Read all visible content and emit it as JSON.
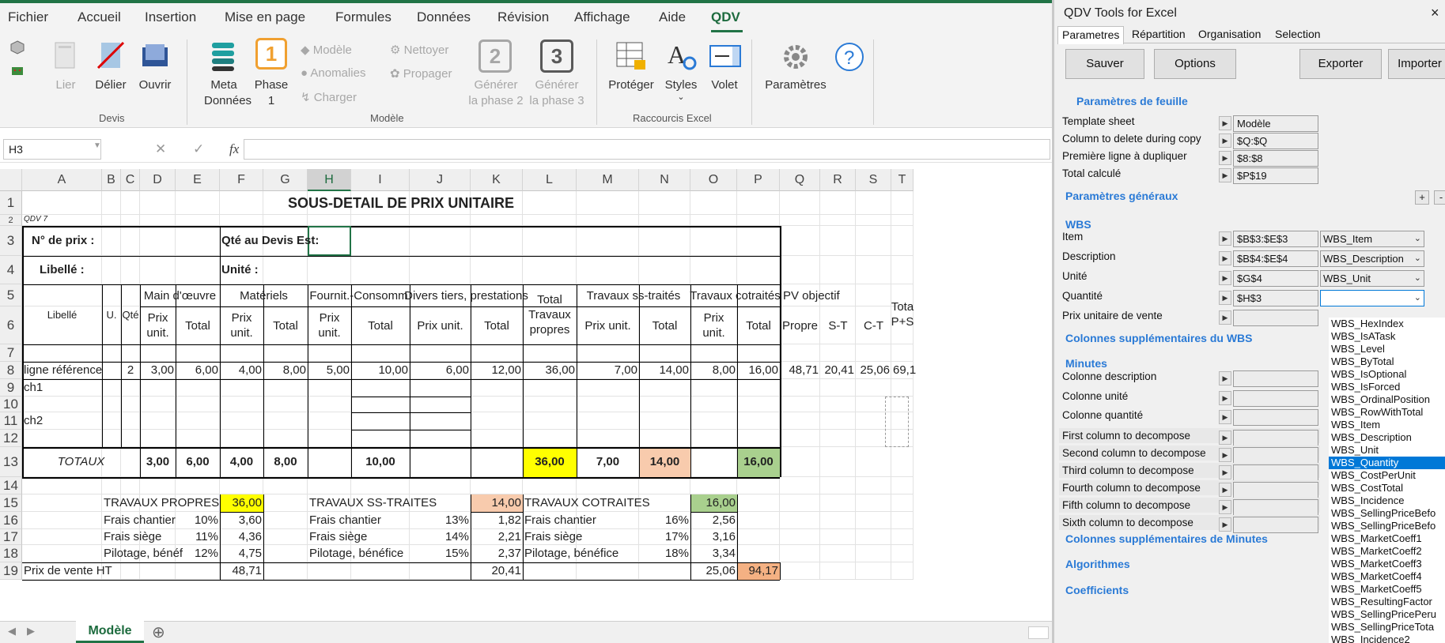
{
  "ribbon": {
    "menus": [
      "Fichier",
      "Accueil",
      "Insertion",
      "Mise en page",
      "Formules",
      "Données",
      "Révision",
      "Affichage",
      "Aide",
      "QDV"
    ],
    "devis": {
      "lier": "Lier",
      "delier": "Délier",
      "ouvrir": "Ouvrir",
      "group": "Devis"
    },
    "modele": {
      "meta1": "Meta",
      "meta2": "Données",
      "phase1": "Phase",
      "phase1b": "1",
      "modele": "Modèle",
      "anomalies": "Anomalies",
      "charger": "Charger",
      "nettoyer": "Nettoyer",
      "propager": "Propager",
      "gen2a": "Générer",
      "gen2b": "la phase 2",
      "gen3a": "Générer",
      "gen3b": "la phase 3",
      "group": "Modèle",
      "phase1_num": "1",
      "gen2_num": "2",
      "gen3_num": "3"
    },
    "raccourcis": {
      "proteger": "Protéger",
      "styles": "Styles",
      "volet": "Volet",
      "group": "Raccourcis Excel"
    },
    "parametres": "Paramètres"
  },
  "formula": {
    "namebox": "H3",
    "fx": "fx",
    "content": ""
  },
  "columns": [
    "A",
    "B",
    "C",
    "D",
    "E",
    "F",
    "G",
    "H",
    "I",
    "J",
    "K",
    "L",
    "M",
    "N",
    "O",
    "P",
    "Q",
    "R",
    "S",
    "T"
  ],
  "rows": [
    "1",
    "2",
    "3",
    "4",
    "5",
    "6",
    "7",
    "8",
    "9",
    "10",
    "11",
    "12",
    "13",
    "14",
    "15",
    "16",
    "17",
    "18",
    "19"
  ],
  "sheet": {
    "title": "SOUS-DETAIL DE PRIX UNITAIRE",
    "qdv": "QDV 7",
    "no_prix": "N° de prix :",
    "qte_devis": "Qté au Devis Est:",
    "libelle": "Libellé :",
    "unite": "Unité :",
    "h_libelle": "Libellé",
    "h_u": "U.",
    "h_qte": "Qté",
    "h_main": "Main d'œuvre",
    "h_mat": "Matériels",
    "h_fourn": "Fournit.-Consomm",
    "h_divers": "Divers tiers, prestations",
    "h_total1": "Total",
    "h_total2": "Travaux",
    "h_total3": "propres",
    "h_ss": "Travaux ss-traités",
    "h_cot": "Travaux cotraités",
    "h_pvobj": "PV objectif",
    "h_prix1": "Prix",
    "h_prix2": "unit.",
    "h_prixunit": "Prix unit.",
    "h_tot": "Total",
    "h_propre": "Propre",
    "h_st": "S-T",
    "h_ct": "C-T",
    "h_tota": "Tota",
    "h_ps": "P+S",
    "r8": {
      "lib": "ligne référence",
      "qte": "2",
      "d": "3,00",
      "e": "6,00",
      "f": "4,00",
      "g": "8,00",
      "h": "5,00",
      "i": "10,00",
      "j": "6,00",
      "k": "12,00",
      "l": "36,00",
      "m": "7,00",
      "n": "14,00",
      "o": "8,00",
      "p": "16,00",
      "q": "48,71",
      "r": "20,41",
      "s": "25,06",
      "t": "69,1"
    },
    "r9": "ch1",
    "r11": "ch2",
    "totaux": {
      "label": "TOTAUX",
      "d": "3,00",
      "e": "6,00",
      "f": "4,00",
      "g": "8,00",
      "i": "10,00",
      "l": "36,00",
      "m": "7,00",
      "n": "14,00",
      "p": "16,00"
    },
    "tp": {
      "label": "TRAVAUX PROPRES",
      "value": "36,00",
      "fc": "Frais chantier",
      "fc_pct": "10%",
      "fc_v": "3,60",
      "fs": "Frais siège",
      "fs_pct": "11%",
      "fs_v": "4,36",
      "pb": "Pilotage, bénéf",
      "pb_pct": "12%",
      "pb_v": "4,75"
    },
    "tst": {
      "label": "TRAVAUX SS-TRAITES",
      "value": "14,00",
      "fc": "Frais chantier",
      "fc_pct": "13%",
      "fc_v": "1,82",
      "fs": "Frais siège",
      "fs_pct": "14%",
      "fs_v": "2,21",
      "pb": "Pilotage, bénéfice",
      "pb_pct": "15%",
      "pb_v": "2,37"
    },
    "tc": {
      "label": "TRAVAUX COTRAITES",
      "value": "16,00",
      "fc": "Frais chantier",
      "fc_pct": "16%",
      "fc_v": "2,56",
      "fs": "Frais siège",
      "fs_pct": "17%",
      "fs_v": "3,16",
      "pb": "Pilotage, bénéfice",
      "pb_pct": "18%",
      "pb_v": "3,34"
    },
    "pv": {
      "label": "Prix de vente HT",
      "f": "48,71",
      "k": "20,41",
      "o": "25,06",
      "p": "94,17"
    },
    "tab": "Modèle"
  },
  "pane": {
    "title": "QDV Tools for Excel",
    "close": "×",
    "tabs": [
      "Parametres",
      "Répartition",
      "Organisation",
      "Selection"
    ],
    "btn_sauver": "Sauver",
    "btn_options": "Options",
    "btn_exporter": "Exporter",
    "btn_importer": "Importer",
    "sec_feuille": "Paramètres de feuille",
    "template_sheet": "Template sheet",
    "template_val": "Modèle",
    "col_delete": "Column to delete during copy",
    "col_delete_val": "$Q:$Q",
    "premiere_ligne": "Première ligne à dupliquer",
    "premiere_val": "$8:$8",
    "total_calc": "Total calculé",
    "total_val": "$P$19",
    "sec_generaux": "Paramètres généraux",
    "plus": "+",
    "minus": "-",
    "sec_wbs": "WBS",
    "item": "Item",
    "item_val": "$B$3:$E$3",
    "item_dd": "WBS_Item",
    "desc": "Description",
    "desc_val": "$B$4:$E$4",
    "desc_dd": "WBS_Description",
    "unite": "Unité",
    "unite_val": "$G$4",
    "unite_dd": "WBS_Unit",
    "quantite": "Quantité",
    "quantite_val": "$H$3",
    "pu_vente": "Prix unitaire de vente",
    "sec_col_wbs": "Colonnes supplémentaires du WBS",
    "sec_minutes": "Minutes",
    "col_desc": "Colonne description",
    "col_unite": "Colonne unité",
    "col_qte": "Colonne quantité",
    "first": "First column to decompose",
    "second": "Second column to decompose",
    "third": "Third column to decompose",
    "fourth": "Fourth column to decompose",
    "fifth": "Fifth column to decompose",
    "sixth": "Sixth column to decompose",
    "sec_col_min": "Colonnes supplémentaires de Minutes",
    "sec_algo": "Algorithmes",
    "sec_coef": "Coefficients",
    "list": [
      "WBS_HexIndex",
      "WBS_IsATask",
      "WBS_Level",
      "WBS_ByTotal",
      "WBS_IsOptional",
      "WBS_IsForced",
      "WBS_OrdinalPosition",
      "WBS_RowWithTotal",
      "WBS_Item",
      "WBS_Description",
      "WBS_Unit",
      "WBS_Quantity",
      "WBS_CostPerUnit",
      "WBS_CostTotal",
      "WBS_Incidence",
      "WBS_SellingPriceBefo",
      "WBS_SellingPriceBefo",
      "WBS_MarketCoeff1",
      "WBS_MarketCoeff2",
      "WBS_MarketCoeff3",
      "WBS_MarketCoeff4",
      "WBS_MarketCoeff5",
      "WBS_ResultingFactor",
      "WBS_SellingPricePeru",
      "WBS_SellingPriceTota",
      "WBS_Incidence2"
    ],
    "list_selected": "WBS_Quantity"
  },
  "colors": {
    "excel_green": "#217346",
    "yellow": "#ffff00",
    "salmon": "#f8cbad",
    "green": "#a9d08e",
    "orange": "#f4b183",
    "link_blue": "#2a7ad6"
  }
}
